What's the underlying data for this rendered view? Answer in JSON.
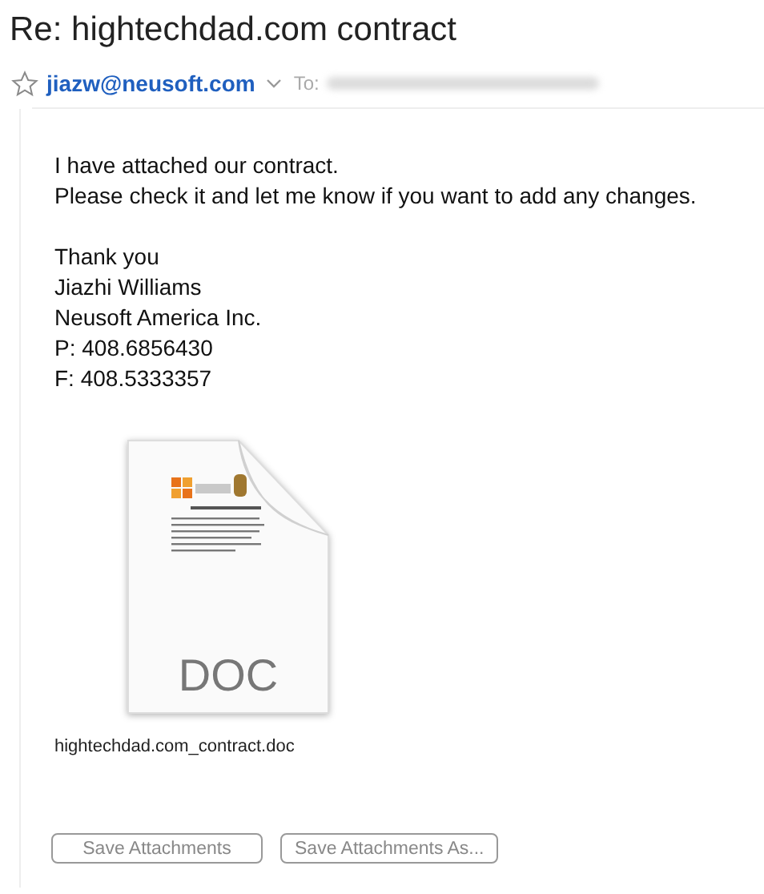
{
  "subject": "Re: hightechdad.com contract",
  "sender": {
    "flagged": false,
    "address": "jiazw@neusoft.com",
    "to_label": "To:"
  },
  "body": [
    [
      "I have attached our contract.",
      "Please check it and let me know if you want to add any changes."
    ],
    [
      "Thank you",
      "Jiazhi Williams",
      "Neusoft America Inc.",
      "P: 408.6856430",
      "F: 408.5333357"
    ]
  ],
  "attachment": {
    "type_label": "DOC",
    "filename": "hightechdad.com_contract.doc"
  },
  "buttons": [
    {
      "label": "Save Attachments",
      "disabled": true
    },
    {
      "label": "Save Attachments As...",
      "disabled": true
    }
  ]
}
